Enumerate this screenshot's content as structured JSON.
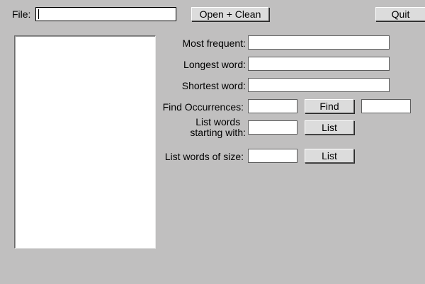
{
  "file_row": {
    "label": "File:",
    "value": "",
    "open_clean_label": "Open + Clean",
    "quit_label": "Quit"
  },
  "word_list": {
    "items": []
  },
  "stats": {
    "most_frequent_label": "Most frequent:",
    "most_frequent_value": "",
    "longest_word_label": "Longest word:",
    "longest_word_value": "",
    "shortest_word_label": "Shortest word:",
    "shortest_word_value": ""
  },
  "find_occurrences": {
    "label": "Find Occurrences:",
    "query": "",
    "button_label": "Find",
    "result": ""
  },
  "starting_with": {
    "label_line1": "List words",
    "label_line2": "starting with:",
    "value": "",
    "button_label": "List"
  },
  "of_size": {
    "label": "List words of size:",
    "value": "",
    "button_label": "List"
  }
}
